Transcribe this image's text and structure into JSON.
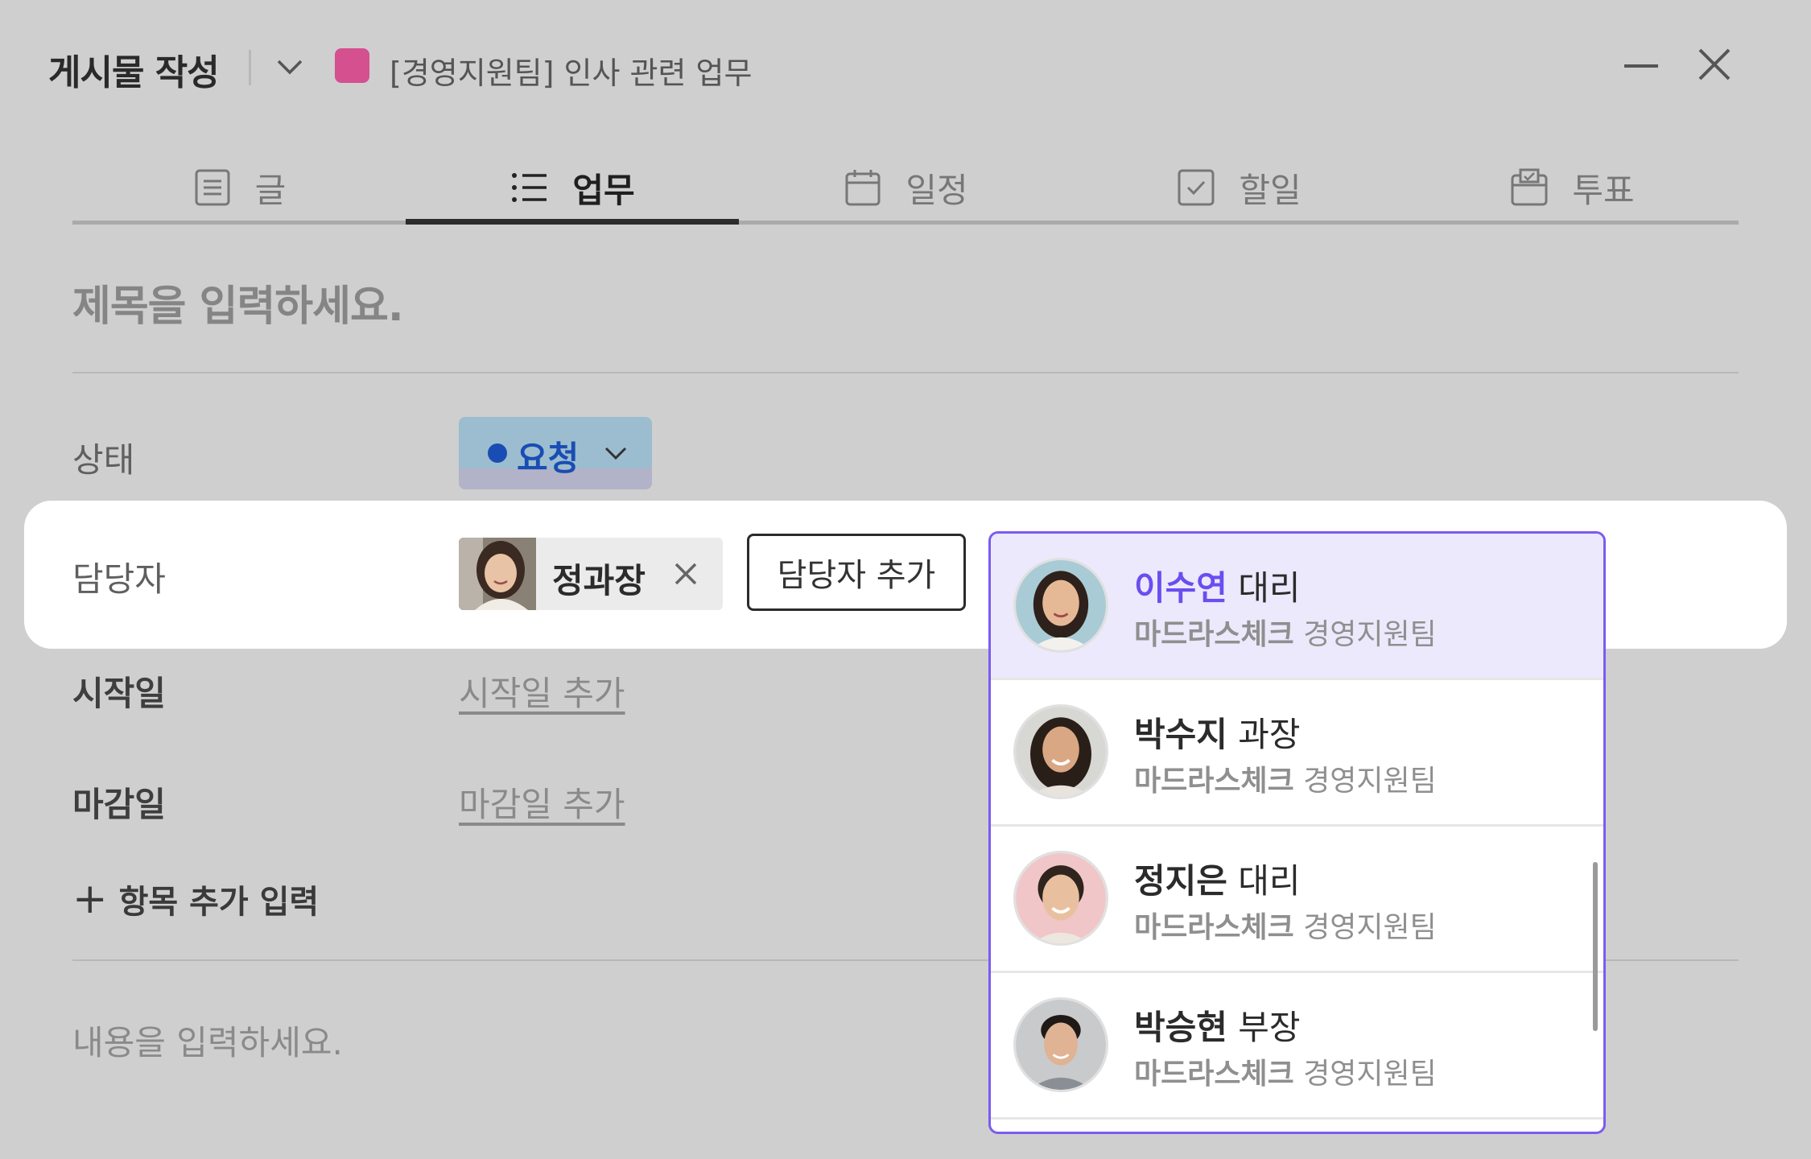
{
  "header": {
    "title": "게시물 작성",
    "board_name": "[경영지원팀] 인사 관련 업무",
    "board_color": "#d4508f"
  },
  "tabs": [
    {
      "label": "글",
      "icon": "document-icon",
      "active": false
    },
    {
      "label": "업무",
      "icon": "list-icon",
      "active": true
    },
    {
      "label": "일정",
      "icon": "calendar-icon",
      "active": false
    },
    {
      "label": "할일",
      "icon": "checkbox-icon",
      "active": false
    },
    {
      "label": "투표",
      "icon": "ballot-box-icon",
      "active": false
    }
  ],
  "form": {
    "title_placeholder": "제목을 입력하세요.",
    "status_label": "상태",
    "status_value": "요청",
    "status_color": "#1a4db3",
    "assignee_label": "담당자",
    "assignee_chip_name": "정과장",
    "add_assignee_label": "담당자 추가",
    "start_label": "시작일",
    "start_link": "시작일 추가",
    "due_label": "마감일",
    "due_link": "마감일 추가",
    "add_field_label": "항목 추가 입력",
    "content_placeholder": "내용을 입력하세요."
  },
  "dropdown": {
    "accent": "#7a5cf0",
    "items": [
      {
        "name": "이수연",
        "title": "대리",
        "company": "마드라스체크",
        "team": "경영지원팀",
        "selected": true
      },
      {
        "name": "박수지",
        "title": "과장",
        "company": "마드라스체크",
        "team": "경영지원팀",
        "selected": false
      },
      {
        "name": "정지은",
        "title": "대리",
        "company": "마드라스체크",
        "team": "경영지원팀",
        "selected": false
      },
      {
        "name": "박승현",
        "title": "부장",
        "company": "마드라스체크",
        "team": "경영지원팀",
        "selected": false
      }
    ]
  }
}
